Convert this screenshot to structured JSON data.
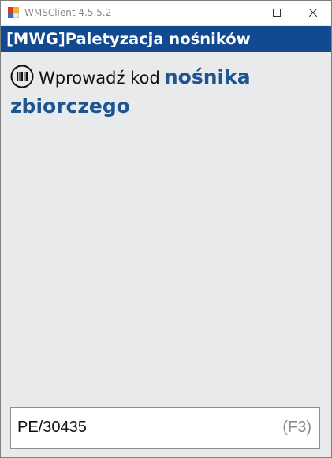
{
  "window": {
    "title": "WMSClient 4.5.5.2"
  },
  "screen": {
    "header": "[MWG]Paletyzacja nośników",
    "prompt": {
      "normal": "Wprowadź kod",
      "bold": "nośnika zbiorczego"
    },
    "input": {
      "value": "PE/30435",
      "shortcut": "(F3)"
    }
  },
  "icons": {
    "app": "app-icon",
    "minimize": "minimize-icon",
    "maximize": "maximize-icon",
    "close": "close-icon",
    "barcode": "barcode-icon"
  },
  "colors": {
    "header_bg": "#12498f",
    "accent_text": "#1d5591",
    "body_bg": "#e9eaec"
  }
}
